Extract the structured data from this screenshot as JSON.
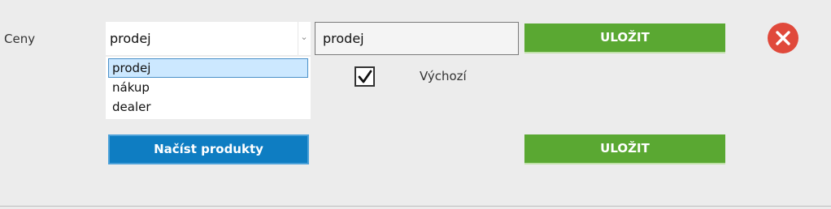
{
  "form": {
    "prices_label": "Ceny",
    "select": {
      "value": "prodej",
      "options": [
        "prodej",
        "nákup",
        "dealer"
      ],
      "selected_index": 0
    },
    "name_input": {
      "value": "prodej"
    },
    "save_top_label": "ULOŽIT",
    "save_bottom_label": "ULOŽIT",
    "default_checkbox": {
      "checked": true,
      "label": "Výchozí"
    },
    "load_products_label": "Načíst produkty",
    "icons": {
      "close": "close-circle-icon",
      "chevron": "chevron-down-icon",
      "check": "checkmark-icon"
    }
  },
  "colors": {
    "green": "#5aa832",
    "blue": "#0e7dc2",
    "close_red": "#e0493b",
    "selected_option": "#cce8ff"
  }
}
